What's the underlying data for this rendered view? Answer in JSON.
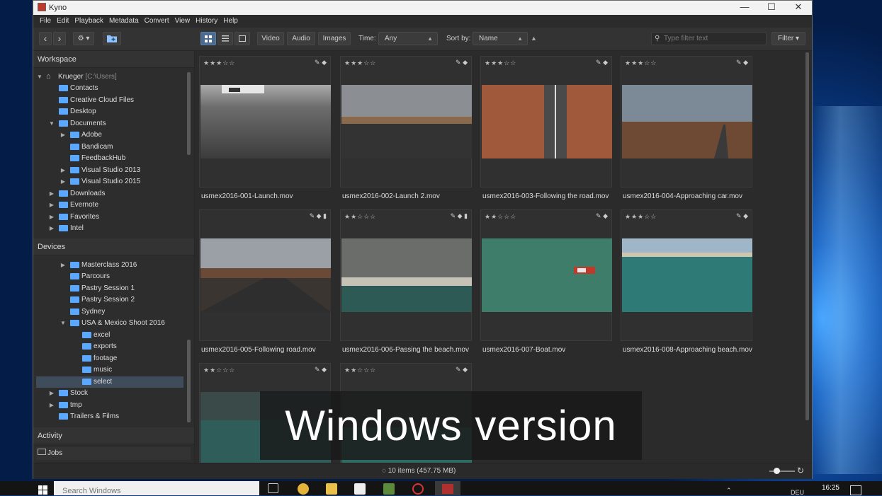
{
  "window": {
    "title": "Kyno",
    "minimize": "—",
    "maximize": "☐",
    "close": "✕"
  },
  "menu": [
    "File",
    "Edit",
    "Playback",
    "Metadata",
    "Convert",
    "View",
    "History",
    "Help"
  ],
  "toolbar": {
    "back": "‹",
    "forward": "›",
    "settings": "⚙ ▾",
    "video": "Video",
    "audio": "Audio",
    "images": "Images",
    "time_label": "Time:",
    "time_value": "Any",
    "sort_label": "Sort by:",
    "sort_value": "Name",
    "sort_dir": "▲",
    "search_placeholder": "Type filter text",
    "filter": "Filter ▾"
  },
  "workspace": {
    "heading": "Workspace",
    "root_label": "Krueger",
    "root_path": "[C:\\Users]",
    "items": [
      "Contacts",
      "Creative Cloud Files",
      "Desktop",
      "Documents",
      "Adobe",
      "Bandicam",
      "FeedbackHub",
      "Visual Studio 2013",
      "Visual Studio 2015",
      "Downloads",
      "Evernote",
      "Favorites",
      "Intel"
    ]
  },
  "devices": {
    "heading": "Devices",
    "items": [
      "Masterclass 2016",
      "Parcours",
      "Pastry Session 1",
      "Pastry Session 2",
      "Sydney",
      "USA & Mexico Shoot 2016",
      "excel",
      "exports",
      "footage",
      "music",
      "select",
      "Stock",
      "tmp",
      "Trailers & Films"
    ]
  },
  "activity": {
    "heading": "Activity"
  },
  "jobs": {
    "label": "Jobs"
  },
  "clips": [
    {
      "name": "usmex2016-001-Launch.mov",
      "stars": "★★★☆☆",
      "tools": "✎ ◆"
    },
    {
      "name": "usmex2016-002-Launch 2.mov",
      "stars": "★★★☆☆",
      "tools": "✎ ◆"
    },
    {
      "name": "usmex2016-003-Following the road.mov",
      "stars": "★★★☆☆",
      "tools": "✎ ◆"
    },
    {
      "name": "usmex2016-004-Approaching car.mov",
      "stars": "★★★☆☆",
      "tools": "✎ ◆"
    },
    {
      "name": "usmex2016-005-Following road.mov",
      "stars": "",
      "tools": "✎ ◆ ▮"
    },
    {
      "name": "usmex2016-006-Passing the beach.mov",
      "stars": "★★☆☆☆",
      "tools": "✎ ◆ ▮"
    },
    {
      "name": "usmex2016-007-Boat.mov",
      "stars": "★★☆☆☆",
      "tools": "✎ ◆"
    },
    {
      "name": "usmex2016-008-Approaching beach.mov",
      "stars": "★★★☆☆",
      "tools": "✎ ◆"
    },
    {
      "name": "",
      "stars": "★★☆☆☆",
      "tools": "✎ ◆"
    },
    {
      "name": "",
      "stars": "★★☆☆☆",
      "tools": "✎ ◆"
    }
  ],
  "status": {
    "text": "10 items (457.75 MB)"
  },
  "overlay": {
    "caption": "Windows version"
  },
  "taskbar": {
    "search": "Search Windows",
    "lang": "DEU",
    "time": "16:25"
  }
}
